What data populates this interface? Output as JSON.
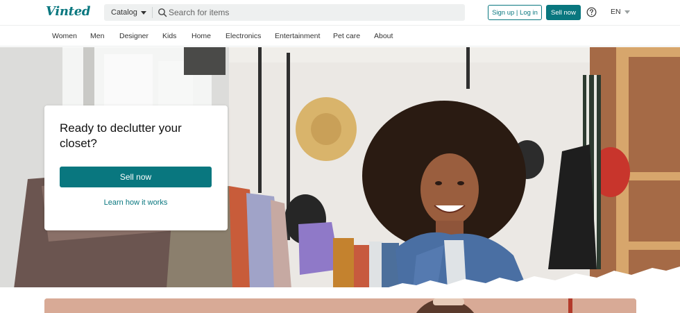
{
  "header": {
    "logo_text": "Vinted",
    "catalog_label": "Catalog",
    "search_placeholder": "Search for items",
    "signup_label": "Sign up | Log in",
    "sell_label": "Sell now",
    "language": "EN",
    "icons": {
      "search": "search-icon",
      "help": "help-icon",
      "catalog_caret": "chevron-down-icon",
      "lang_caret": "chevron-down-icon"
    }
  },
  "catnav": {
    "items": [
      {
        "label": "Women"
      },
      {
        "label": "Men"
      },
      {
        "label": "Designer"
      },
      {
        "label": "Kids"
      },
      {
        "label": "Home"
      },
      {
        "label": "Electronics"
      },
      {
        "label": "Entertainment"
      },
      {
        "label": "Pet care"
      },
      {
        "label": "About"
      }
    ]
  },
  "hero": {
    "title": "Ready to declutter your closet?",
    "sell_button": "Sell now",
    "learn_link": "Learn how it works"
  },
  "colors": {
    "brand": "#09777f",
    "search_bg": "#eef0f0",
    "promo_bg": "#d8aa96"
  }
}
